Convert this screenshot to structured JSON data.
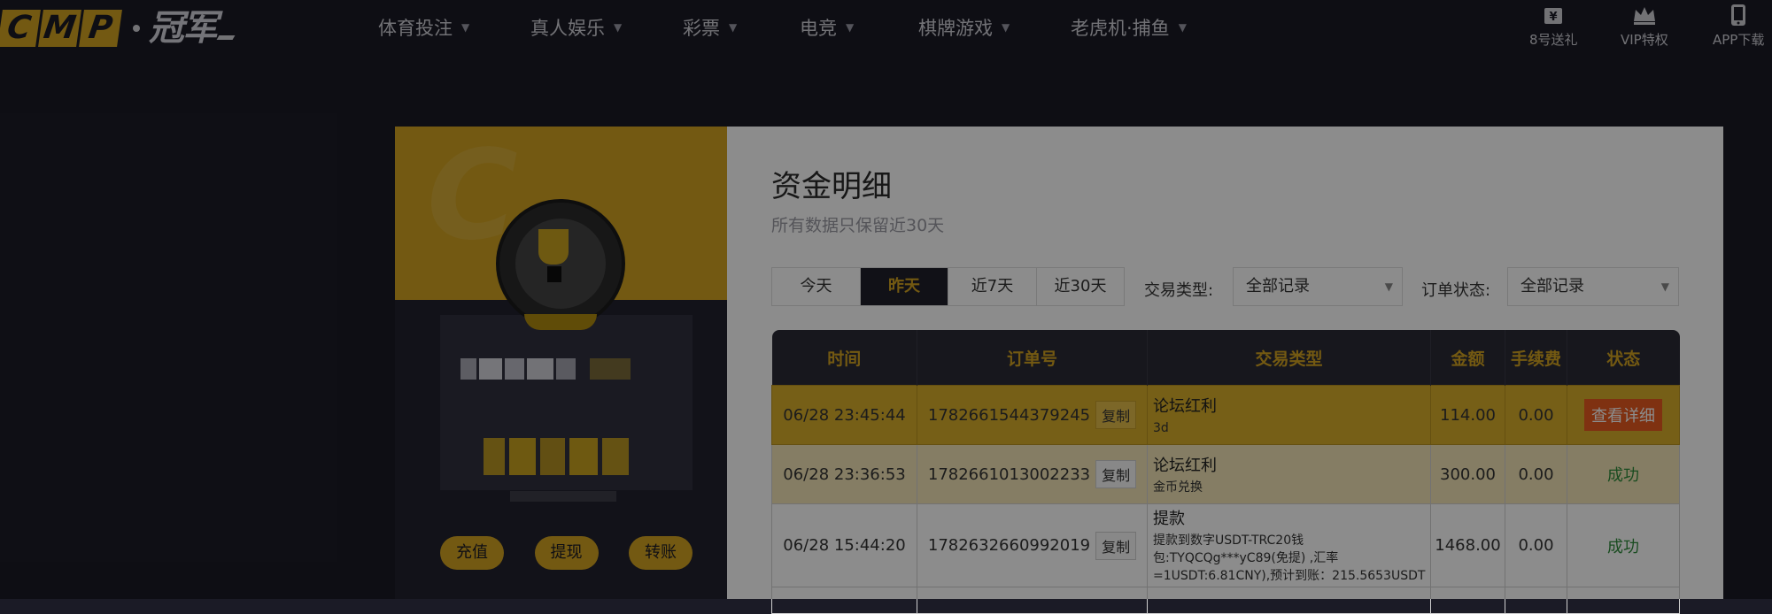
{
  "brand": {
    "letters": [
      "C",
      "M",
      "P"
    ],
    "cn": "冠军"
  },
  "nav": {
    "items": [
      {
        "label": "体育投注"
      },
      {
        "label": "真人娱乐"
      },
      {
        "label": "彩票"
      },
      {
        "label": "电竞"
      },
      {
        "label": "棋牌游戏"
      },
      {
        "label": "老虎机·捕鱼"
      }
    ]
  },
  "quick_links": [
    {
      "label": "8号送礼",
      "icon": "gift-icon"
    },
    {
      "label": "VIP特权",
      "icon": "crown-icon"
    },
    {
      "label": "APP下载",
      "icon": "phone-icon"
    }
  ],
  "profile": {
    "actions": [
      {
        "label": "充值"
      },
      {
        "label": "提现"
      },
      {
        "label": "转账"
      }
    ]
  },
  "page": {
    "title": "资金明细",
    "subtitle": "所有数据只保留近30天"
  },
  "date_filters": [
    {
      "label": "今天",
      "active": false
    },
    {
      "label": "昨天",
      "active": true
    },
    {
      "label": "近7天",
      "active": false
    },
    {
      "label": "近30天",
      "active": false
    }
  ],
  "filters": {
    "type_label": "交易类型:",
    "type_value": "全部记录",
    "status_label": "订单状态:",
    "status_value": "全部记录"
  },
  "table": {
    "headers": [
      "时间",
      "订单号",
      "交易类型",
      "金额",
      "手续费",
      "状态"
    ],
    "copy_label": "复制",
    "rows": [
      {
        "time": "06/28 23:45:44",
        "order": "1782661544379245",
        "type_title": "论坛红利",
        "type_desc": "3d",
        "amount": "114.00",
        "fee": "0.00",
        "status": "查看详细",
        "status_kind": "detail"
      },
      {
        "time": "06/28 23:36:53",
        "order": "1782661013002233",
        "type_title": "论坛红利",
        "type_desc": "金币兑换",
        "amount": "300.00",
        "fee": "0.00",
        "status": "成功",
        "status_kind": "success"
      },
      {
        "time": "06/28 15:44:20",
        "order": "1782632660992019",
        "type_title": "提款",
        "type_desc": "提款到数字USDT-TRC20钱包:TYQCQg***yC89(免提) ,汇率=1USDT:6.81CNY),预计到账：215.5653USDT",
        "amount": "1468.00",
        "fee": "0.00",
        "status": "成功",
        "status_kind": "success"
      }
    ]
  },
  "colors": {
    "accent": "#d2a321",
    "nav_bg": "#1b1b26",
    "detail": "#e85a20",
    "success": "#2f8a3b"
  }
}
